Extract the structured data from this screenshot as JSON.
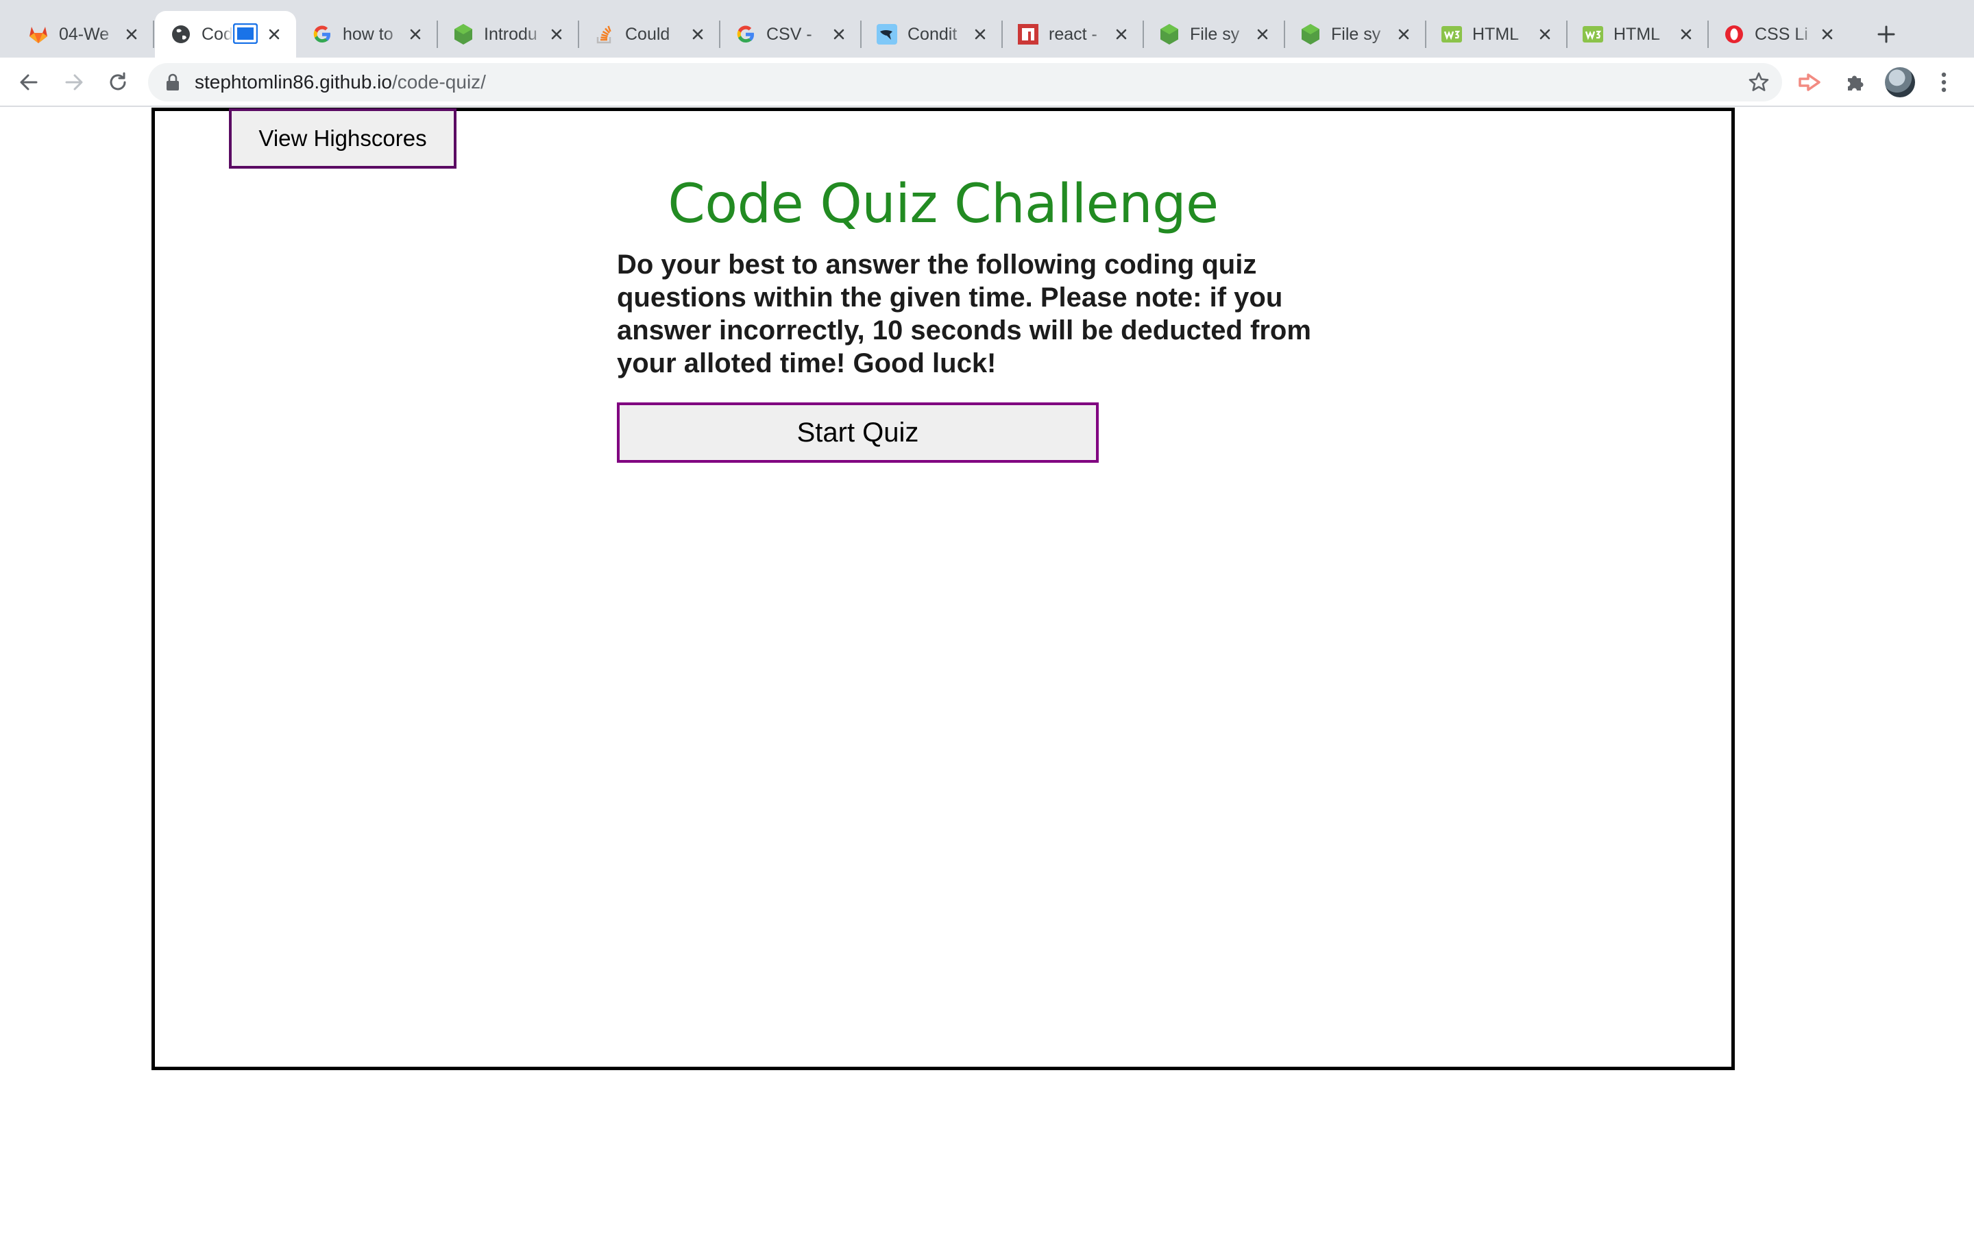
{
  "browser": {
    "tabs": [
      {
        "title": "04-We",
        "icon": "gitlab-icon"
      },
      {
        "title": "Code Quiz",
        "icon": "globe-icon"
      },
      {
        "title": "how to",
        "icon": "google-icon"
      },
      {
        "title": "Introdu",
        "icon": "nodejs-icon"
      },
      {
        "title": "Could",
        "icon": "stackoverflow-icon"
      },
      {
        "title": "CSV -",
        "icon": "google-icon"
      },
      {
        "title": "Condit",
        "icon": "bird-icon"
      },
      {
        "title": "react -",
        "icon": "npm-icon"
      },
      {
        "title": "File sy",
        "icon": "nodejs-icon"
      },
      {
        "title": "File sy",
        "icon": "nodejs-icon"
      },
      {
        "title": "HTML",
        "icon": "w3schools-icon"
      },
      {
        "title": "HTML",
        "icon": "w3schools-icon"
      },
      {
        "title": "CSS Li",
        "icon": "opera-icon"
      }
    ],
    "active_tab": 1,
    "url_host": "stephtomlin86.github.io",
    "url_path": "/code-quiz/"
  },
  "page": {
    "highscores_label": "View Highscores",
    "title": "Code Quiz Challenge",
    "description": "Do your best to answer the following coding quiz questions within the given time. Please note: if you answer incorrectly, 10 seconds will be deducted from your alloted time! Good luck!",
    "start_label": "Start Quiz"
  },
  "colors": {
    "title": "#228b22",
    "button_border": "#800080",
    "tabstrip": "#dee1e6"
  }
}
